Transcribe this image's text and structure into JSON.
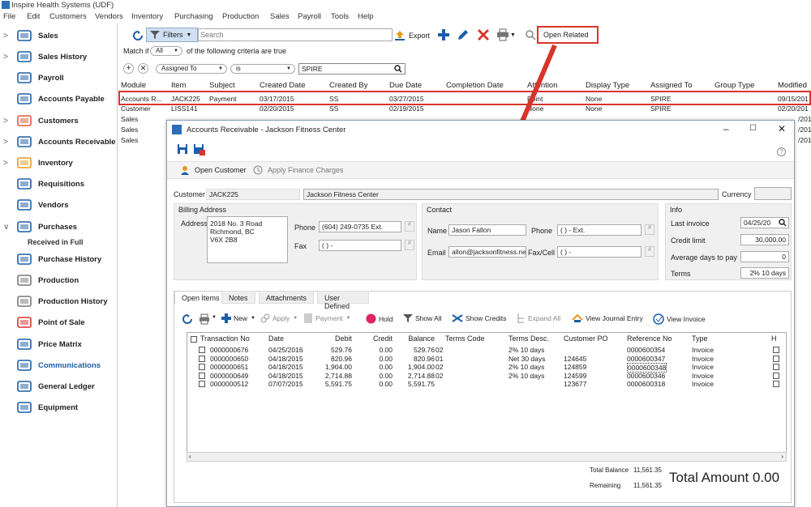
{
  "app": {
    "title": "Inspire Health Systems (UDF)"
  },
  "menu": [
    "File",
    "Edit",
    "Customers",
    "Vendors",
    "Inventory",
    "Purchasing",
    "Production",
    "Sales",
    "Payroll",
    "Tools",
    "Help"
  ],
  "sidebar": [
    {
      "label": "Sales",
      "chev": ">",
      "icon": "cart-icon"
    },
    {
      "label": "Sales History",
      "chev": ">",
      "icon": "history-icon"
    },
    {
      "label": "Payroll",
      "chev": "",
      "icon": "payroll-icon"
    },
    {
      "label": "Accounts Payable",
      "chev": "",
      "icon": "accounts-payable-icon"
    },
    {
      "label": "Customers",
      "chev": ">",
      "icon": "customers-icon"
    },
    {
      "label": "Accounts Receivable",
      "chev": ">",
      "icon": "accounts-receivable-icon"
    },
    {
      "label": "Inventory",
      "chev": ">",
      "icon": "inventory-icon"
    },
    {
      "label": "Requisitions",
      "chev": "",
      "icon": "requisitions-icon"
    },
    {
      "label": "Vendors",
      "chev": "",
      "icon": "vendors-icon"
    },
    {
      "label": "Purchases",
      "chev": "v",
      "icon": "purchases-icon"
    },
    {
      "label": "Purchase History",
      "chev": "",
      "icon": "purchase-history-icon"
    },
    {
      "label": "Production",
      "chev": "",
      "icon": "production-icon"
    },
    {
      "label": "Production History",
      "chev": "",
      "icon": "production-history-icon"
    },
    {
      "label": "Point of Sale",
      "chev": "",
      "icon": "point-of-sale-icon"
    },
    {
      "label": "Price Matrix",
      "chev": "",
      "icon": "price-matrix-icon"
    },
    {
      "label": "Communications",
      "chev": "",
      "icon": "communications-icon"
    },
    {
      "label": "General Ledger",
      "chev": "",
      "icon": "general-ledger-icon"
    },
    {
      "label": "Equipment",
      "chev": "",
      "icon": "equipment-icon"
    }
  ],
  "sidebar_sub": "Received in Full",
  "toolbar": {
    "filters": "Filters",
    "search_placeholder": "Search",
    "export": "Export",
    "open_related": "Open Related"
  },
  "filter": {
    "match_if": "Match if",
    "all": "All",
    "criteria": "of the following criteria are true"
  },
  "criteria": {
    "field": "Assigned To",
    "op": "is",
    "value": "SPIRE"
  },
  "grid": {
    "headers": [
      "Module",
      "Item",
      "Subject",
      "Created Date",
      "Created By",
      "Due Date",
      "Completion Date",
      "Attention",
      "Display Type",
      "Assigned To",
      "Group Type",
      "Modified"
    ],
    "rows": [
      [
        "Accounts R...",
        "JACK225",
        "Payment",
        "03/17/2015",
        "SS",
        "03/27/2015",
        "",
        "Point",
        "None",
        "SPIRE",
        "",
        "09/15/201"
      ],
      [
        "Customer",
        "LISS141",
        "",
        "02/20/2015",
        "SS",
        "02/19/2015",
        "",
        "None",
        "None",
        "SPIRE",
        "",
        "02/20/201"
      ],
      [
        "Sales",
        "",
        "",
        "",
        "",
        "",
        "",
        "",
        "",
        "",
        "",
        "/201"
      ],
      [
        "Sales",
        "",
        "",
        "",
        "",
        "",
        "",
        "",
        "",
        "",
        "",
        "/201"
      ],
      [
        "Sales",
        "",
        "",
        "",
        "",
        "",
        "",
        "",
        "",
        "",
        "",
        "/201"
      ]
    ]
  },
  "dialog": {
    "title": "Accounts Receivable - Jackson Fitness Center",
    "open_customer": "Open Customer",
    "apply_finance": "Apply Finance Charges",
    "customer_label": "Customer",
    "customer_code": "JACK225",
    "customer_name": "Jackson Fitness Center",
    "currency_label": "Currency",
    "billing": {
      "title": "Billing Address",
      "address_label": "Address",
      "address": [
        "2018 No. 3 Road",
        "Richmond, BC",
        "V6X 2B8"
      ],
      "phone_label": "Phone",
      "phone": "(604) 249-0735 Ext.",
      "fax_label": "Fax",
      "fax": "(  )   -"
    },
    "contact": {
      "title": "Contact",
      "name_label": "Name",
      "name": "Jason Fallon",
      "phone_label": "Phone",
      "phone": "(  )   -   Ext.",
      "email_label": "Email",
      "email": "allon@jacksonfitness.net",
      "fax_label": "Fax/Cell",
      "fax": "(  )   -"
    },
    "info": {
      "title": "Info",
      "last_invoice_label": "Last invoice",
      "last_invoice": "04/25/20",
      "credit_label": "Credit limit",
      "credit": "30,000.00",
      "avg_label": "Average days to pay",
      "avg": "0",
      "terms_label": "Terms",
      "terms": "2% 10 days"
    },
    "tabs": [
      "Open Items",
      "Notes",
      "Attachments",
      "User Defined"
    ],
    "tb": {
      "new": "New",
      "apply": "Apply",
      "payment": "Payment",
      "hold": "Hold",
      "show_all": "Show All",
      "show_credits": "Show Credits",
      "expand_all": "Expand All",
      "journal": "View Journal Entry",
      "invoice": "View Invoice"
    },
    "items_headers": [
      "Transaction No",
      "Date",
      "Debit",
      "Credit",
      "Balance",
      "Terms Code",
      "Terms Desc.",
      "Customer PO",
      "Reference No",
      "Type",
      "H"
    ],
    "items": [
      [
        "0000000676",
        "04/25/2016",
        "529.76",
        "0.00",
        "529.76",
        "02",
        "2% 10 days",
        "",
        "0000600354",
        "Invoice"
      ],
      [
        "0000000650",
        "04/18/2015",
        "820.96",
        "0.00",
        "820.96",
        "01",
        "Net 30 days",
        "124645",
        "0000600347",
        "Invoice"
      ],
      [
        "0000000651",
        "04/18/2015",
        "1,904.00",
        "0.00",
        "1,904.00",
        "02",
        "2% 10 days",
        "124859",
        "0000600348",
        "Invoice"
      ],
      [
        "0000000649",
        "04/18/2015",
        "2,714.88",
        "0.00",
        "2,714.88",
        "02",
        "2% 10 days",
        "124599",
        "0000600346",
        "Invoice"
      ],
      [
        "0000000512",
        "07/07/2015",
        "5,591.75",
        "0.00",
        "5,591.75",
        "",
        "",
        "123677",
        "0000600318",
        "Invoice"
      ]
    ],
    "total_balance_label": "Total Balance",
    "total_balance": "11,561.35",
    "remaining_label": "Remaining",
    "remaining": "11,561.35",
    "total_amount": "Total Amount 0.00"
  },
  "colors": {
    "accent": "#1a5ea8",
    "highlight_red": "#d9342b"
  }
}
